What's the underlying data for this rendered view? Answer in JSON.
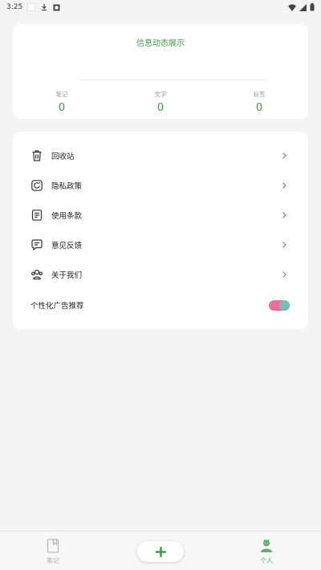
{
  "status_bar": {
    "time": "3:25"
  },
  "stats": {
    "title": "信息动态展示",
    "items": [
      {
        "label": "笔记",
        "value": "0"
      },
      {
        "label": "文字",
        "value": "0"
      },
      {
        "label": "标签",
        "value": "0"
      }
    ]
  },
  "menu": {
    "items": [
      {
        "label": "回收站",
        "icon": "trash-icon"
      },
      {
        "label": "隐私政策",
        "icon": "privacy-icon"
      },
      {
        "label": "使用条款",
        "icon": "terms-icon"
      },
      {
        "label": "意见反馈",
        "icon": "feedback-icon"
      },
      {
        "label": "关于我们",
        "icon": "about-us-icon"
      }
    ],
    "toggle": {
      "label": "个性化广告推荐",
      "enabled": true
    }
  },
  "nav": {
    "notes_label": "笔记",
    "profile_label": "个人",
    "active": "profile"
  },
  "colors": {
    "accent": "#3f9a41",
    "toggle_track": "#f06d9a",
    "toggle_knob": "#6fc2b6"
  }
}
